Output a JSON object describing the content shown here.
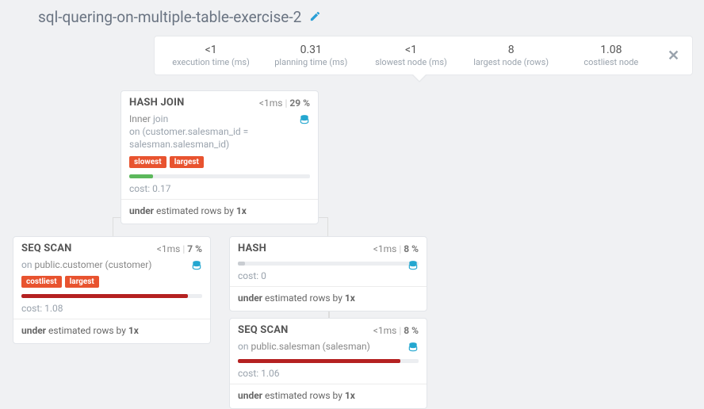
{
  "title": "sql-quering-on-multiple-table-exercise-2",
  "summary": {
    "execution_time": {
      "value": "<1",
      "label": "execution time (ms)"
    },
    "planning_time": {
      "value": "0.31",
      "label": "planning time (ms)"
    },
    "slowest_node": {
      "value": "<1",
      "label": "slowest node (ms)"
    },
    "largest_node": {
      "value": "8",
      "label": "largest node (rows)"
    },
    "costliest_node": {
      "value": "1.08",
      "label": "costliest node"
    }
  },
  "nodes": {
    "hash_join": {
      "name": "HASH JOIN",
      "time": "<1ms",
      "pct": "29 %",
      "detail_prefix": "Inner ",
      "detail_join": "join",
      "detail_line2": "on (customer.salesman_id = salesman.salesman_id)",
      "tags": [
        "slowest",
        "largest"
      ],
      "bar_width": "13%",
      "bar_class": "bar-green",
      "cost_label": "cost: ",
      "cost": "0.17",
      "est_under": "under",
      "est_mid": " estimated rows by ",
      "est_mult": "1x"
    },
    "seq_scan_customer": {
      "name": "SEQ SCAN",
      "time": "<1ms",
      "pct": "7 %",
      "detail_prefix": "on ",
      "detail_table": "public.customer (customer)",
      "tags": [
        "costliest",
        "largest"
      ],
      "bar_width": "92%",
      "bar_class": "bar-red",
      "cost_label": "cost: ",
      "cost": "1.08",
      "est_under": "under",
      "est_mid": " estimated rows by ",
      "est_mult": "1x"
    },
    "hash": {
      "name": "HASH",
      "time": "<1ms",
      "pct": "8 %",
      "bar_width": "4%",
      "bar_class": "bar-gray",
      "cost_label": "cost: ",
      "cost": "0",
      "est_under": "under",
      "est_mid": " estimated rows by ",
      "est_mult": "1x"
    },
    "seq_scan_salesman": {
      "name": "SEQ SCAN",
      "time": "<1ms",
      "pct": "8 %",
      "detail_prefix": "on ",
      "detail_table": "public.salesman (salesman)",
      "bar_width": "90%",
      "bar_class": "bar-red",
      "cost_label": "cost: ",
      "cost": "1.06",
      "est_under": "under",
      "est_mid": " estimated rows by ",
      "est_mult": "1x"
    }
  }
}
